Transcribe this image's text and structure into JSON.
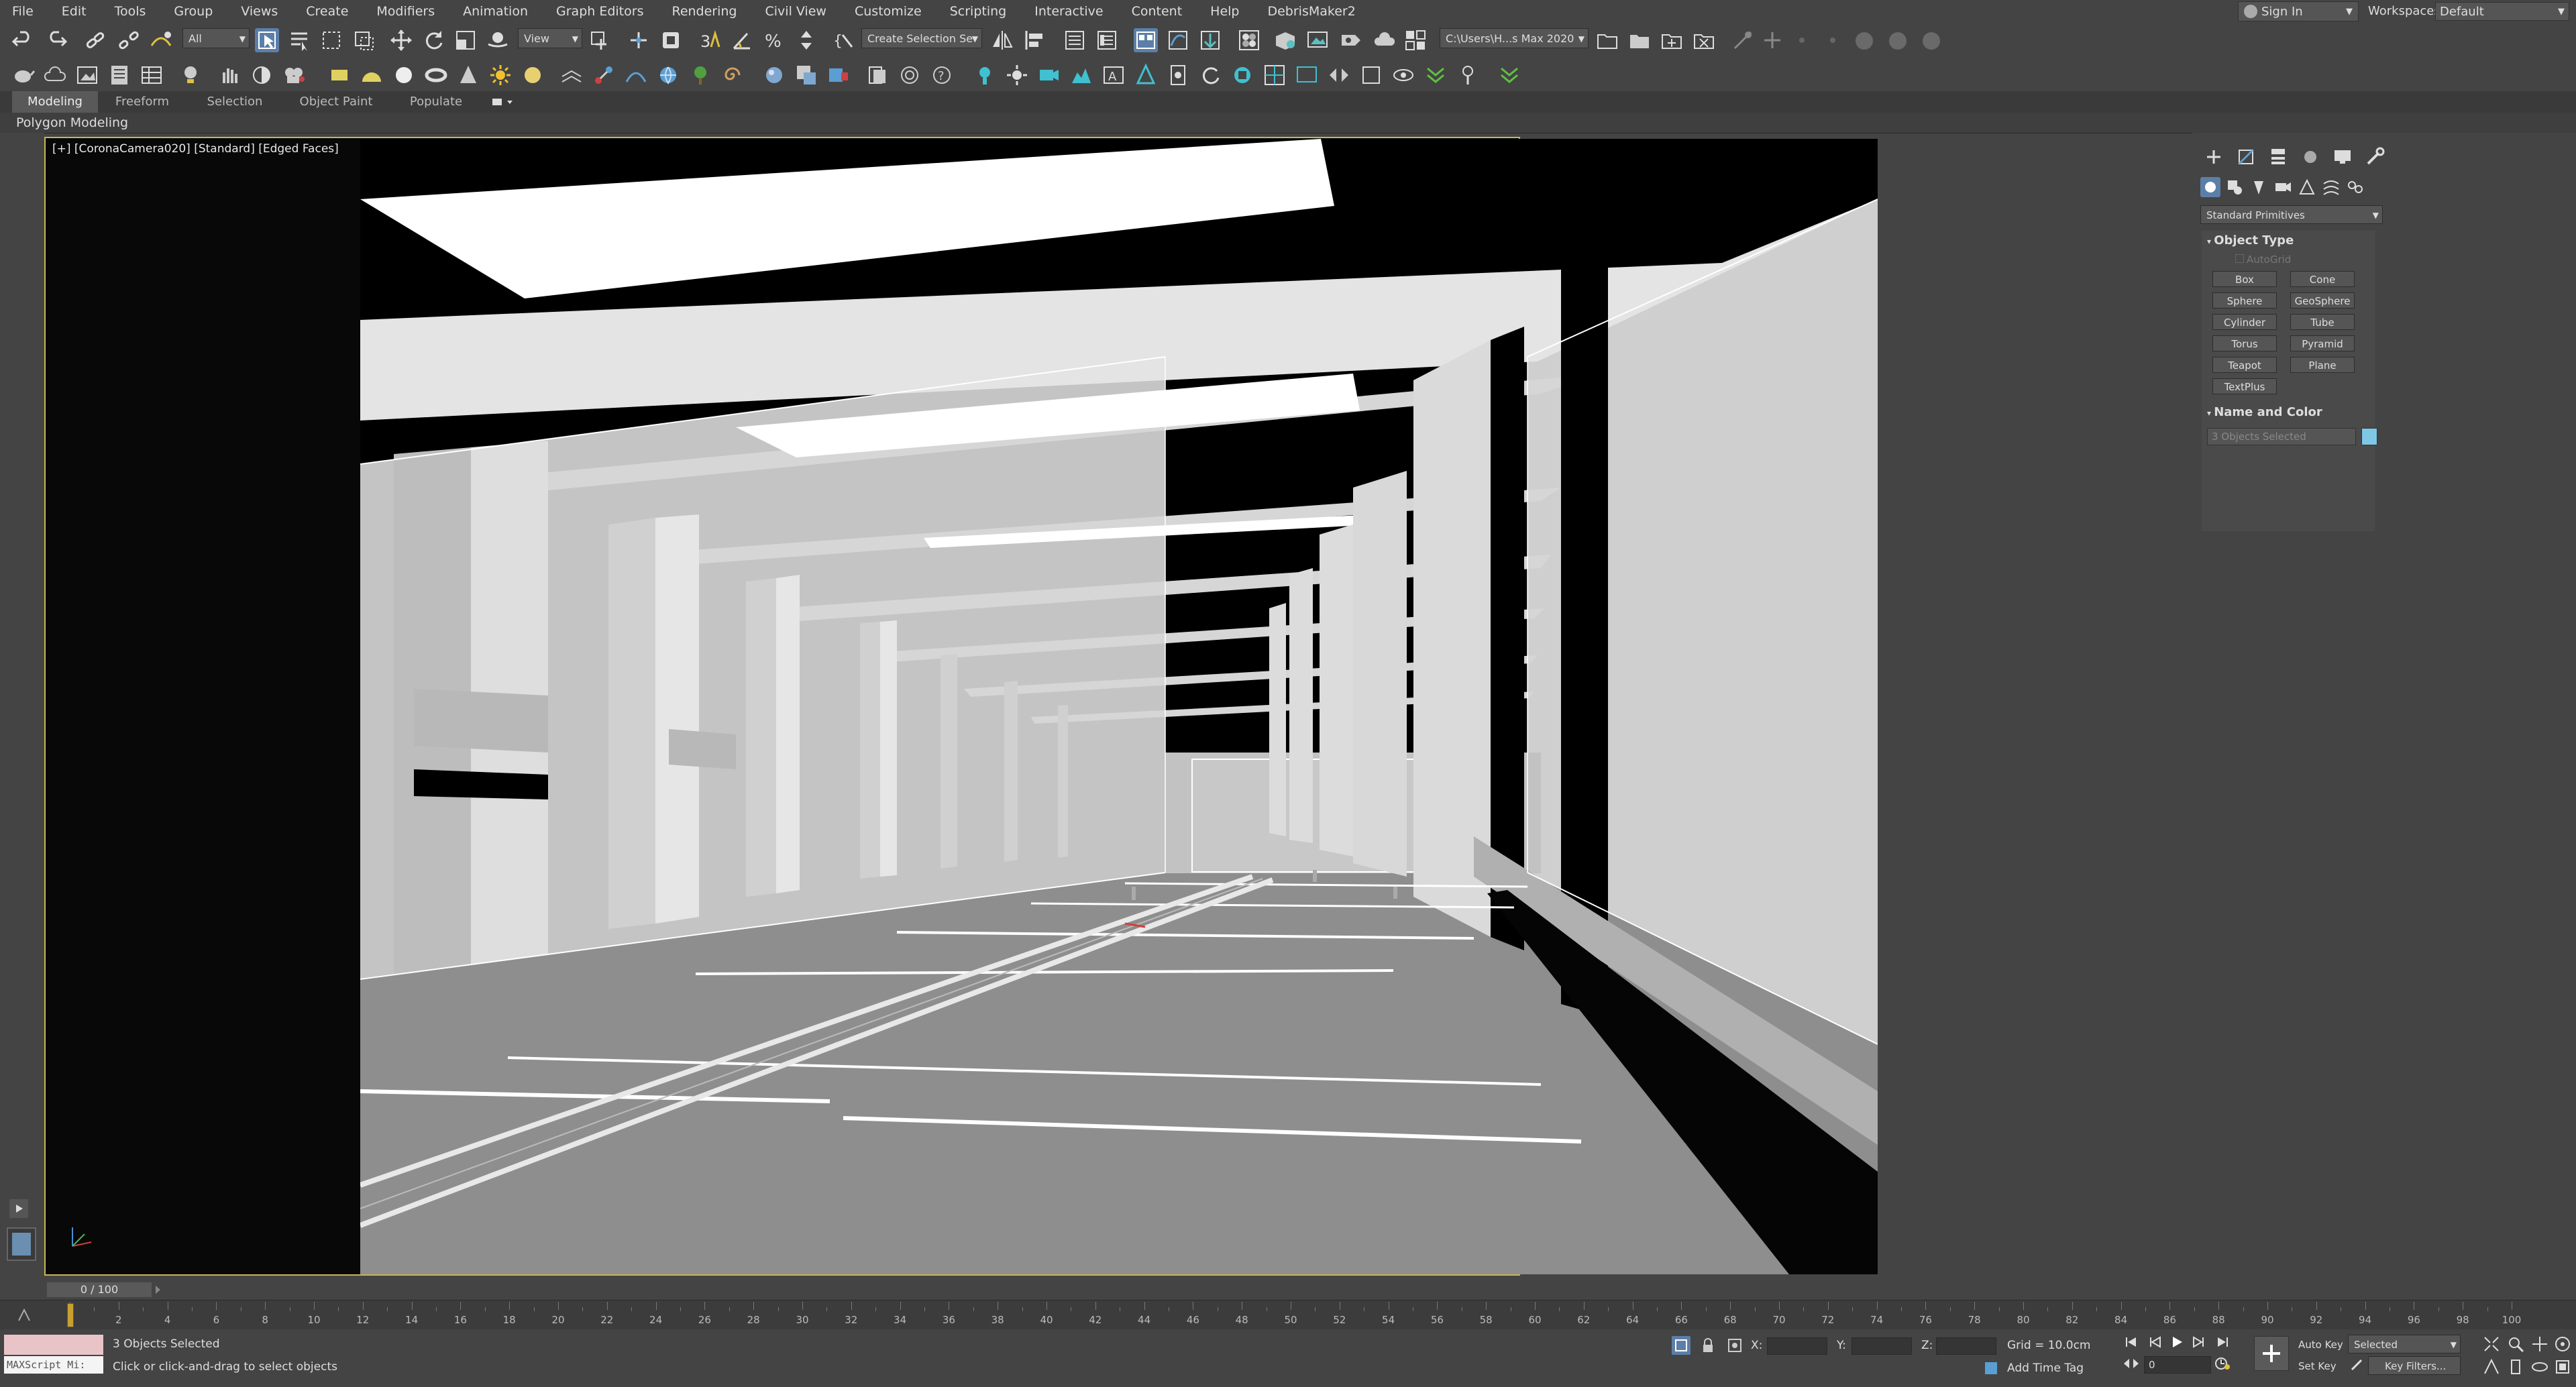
{
  "menu": {
    "items": [
      "File",
      "Edit",
      "Tools",
      "Group",
      "Views",
      "Create",
      "Modifiers",
      "Animation",
      "Graph Editors",
      "Rendering",
      "Civil View",
      "Customize",
      "Scripting",
      "Interactive",
      "Content",
      "Help",
      "DebrisMaker2"
    ]
  },
  "account": {
    "signin_label": "Sign In"
  },
  "workspaces": {
    "label": "Workspaces:",
    "value": "Default"
  },
  "toolbar": {
    "selection_filter": "All",
    "ref_coord": "View",
    "named_selection_placeholder": "Create Selection Se",
    "project_path": "C:\\Users\\H...s Max 2020"
  },
  "ribbon": {
    "tabs": [
      "Modeling",
      "Freeform",
      "Selection",
      "Object Paint",
      "Populate"
    ],
    "active_tab": "Modeling",
    "sub_label": "Polygon Modeling"
  },
  "viewport": {
    "label": "[+] [CoronaCamera020] [Standard] [Edged Faces]",
    "colors": {
      "border": "#c8b650",
      "background": "#080808",
      "surface_light": "#dcdcdc",
      "surface_mid": "#b4b4b4",
      "floor": "#8e8e8e"
    }
  },
  "command_panel": {
    "category": "Standard Primitives",
    "object_type_title": "Object Type",
    "autogrid_label": "AutoGrid",
    "buttons": [
      "Box",
      "Cone",
      "Sphere",
      "GeoSphere",
      "Cylinder",
      "Tube",
      "Torus",
      "Pyramid",
      "Teapot",
      "Plane",
      "TextPlus"
    ],
    "name_color_title": "Name and Color",
    "name_field": "3 Objects Selected",
    "object_color": "#7ec8e6"
  },
  "timeline": {
    "slider_label": "0 / 100",
    "ticks": [
      "0",
      "2",
      "4",
      "6",
      "8",
      "10",
      "12",
      "14",
      "16",
      "18",
      "20",
      "22",
      "24",
      "26",
      "28",
      "30",
      "32",
      "34",
      "36",
      "38",
      "40",
      "42",
      "44",
      "46",
      "48",
      "50",
      "52",
      "54",
      "56",
      "58",
      "60",
      "62",
      "64",
      "66",
      "68",
      "70",
      "72",
      "74",
      "76",
      "78",
      "80",
      "82",
      "84",
      "86",
      "88",
      "90",
      "92",
      "94",
      "96",
      "98",
      "100"
    ]
  },
  "status": {
    "maxscript_label": "MAXScript Mi:",
    "selection_status": "3 Objects Selected",
    "prompt": "Click or click-and-drag to select objects",
    "x_label": "X:",
    "y_label": "Y:",
    "z_label": "Z:",
    "grid": "Grid = 10.0cm",
    "add_time_tag": "Add Time Tag",
    "auto_key": "Auto Key",
    "set_key": "Set Key",
    "key_mode": "Selected",
    "key_filters": "Key Filters...",
    "frame_value": "0"
  }
}
